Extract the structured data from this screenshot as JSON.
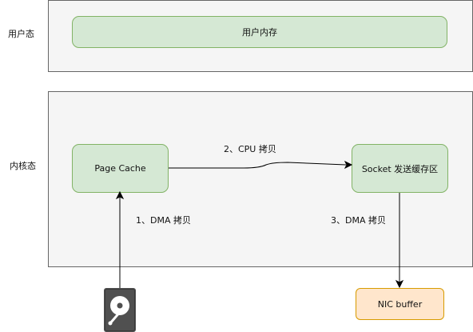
{
  "user_space": {
    "zone_label": "用户态",
    "memory_label": "用户内存"
  },
  "kernel_space": {
    "zone_label": "内核态",
    "page_cache_label": "Page Cache",
    "socket_buffer_label": "Socket 发送缓存区"
  },
  "nic": {
    "label": "NIC buffer"
  },
  "edges": {
    "dma_copy_1": "1、DMA 拷贝",
    "cpu_copy_2": "2、CPU 拷贝",
    "dma_copy_3": "3、DMA 拷贝"
  },
  "icons": {
    "disk": "hard-disk-icon"
  },
  "colors": {
    "zone_fill": "#f5f5f5",
    "zone_border": "#666666",
    "green_fill": "#d5e8d4",
    "green_border": "#82b366",
    "orange_fill": "#ffe6cc",
    "orange_border": "#d79b00"
  }
}
